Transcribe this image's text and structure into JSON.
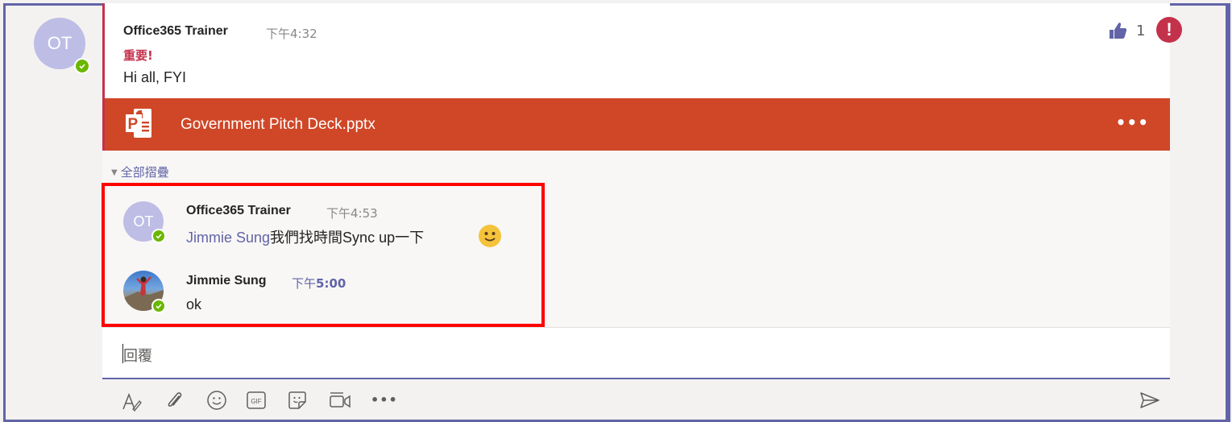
{
  "post": {
    "avatar_initials": "OT",
    "author": "Office365 Trainer",
    "time": "下午4:32",
    "importance_label": "重要!",
    "text": "Hi all, FYI",
    "like_count": "1",
    "urgent_mark": "!"
  },
  "attachment": {
    "name": "Government Pitch Deck.pptx",
    "more_label": "•••",
    "icon": "powerpoint-icon"
  },
  "thread": {
    "collapse_label": "全部摺疊",
    "replies": [
      {
        "avatar_initials": "OT",
        "author": "Office365 Trainer",
        "time": "下午4:53",
        "mention": "Jimmie Sung",
        "text": "我們找時間Sync up一下",
        "emoji": "smile-emoji"
      },
      {
        "author": "Jimmie Sung",
        "time_prefix": "下午",
        "time_value": "5:00",
        "text": "ok"
      }
    ]
  },
  "reply_box": {
    "placeholder": "回覆"
  },
  "toolbar": {
    "icons": [
      "format-icon",
      "attach-icon",
      "emoji-icon",
      "gif-icon",
      "sticker-icon",
      "meet-now-icon",
      "more-options-icon",
      "send-icon"
    ],
    "gif_label": "GIF",
    "more_label": "•••"
  },
  "colors": {
    "accent": "#6264a7",
    "important": "#c4314b",
    "powerpoint": "#d04727",
    "presence": "#6bb700",
    "highlight": "#ff0000"
  }
}
